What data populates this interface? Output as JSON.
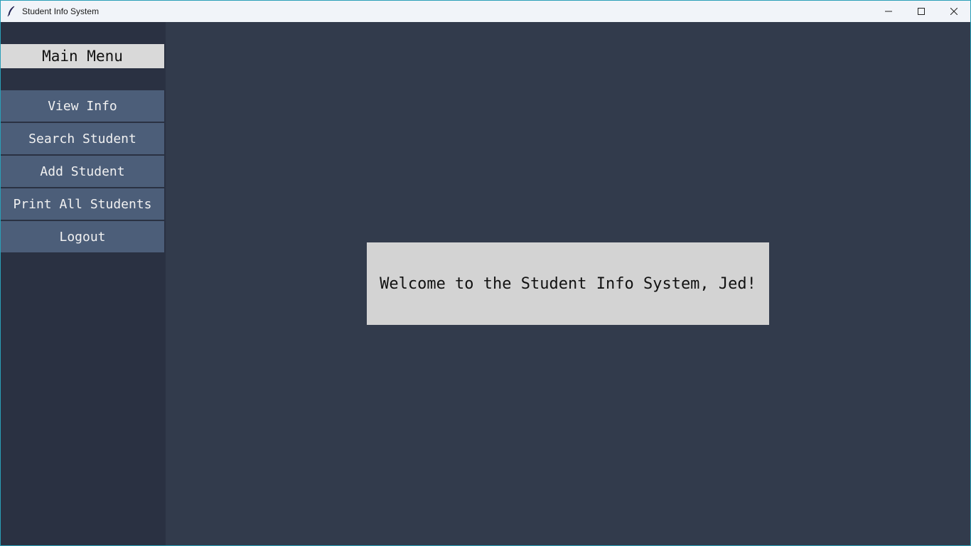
{
  "window": {
    "title": "Student Info System",
    "icon": "feather-icon"
  },
  "window_controls": [
    "minimize-icon",
    "maximize-icon",
    "close-icon"
  ],
  "sidebar": {
    "title": "Main Menu",
    "items": [
      {
        "label": "View Info"
      },
      {
        "label": "Search Student"
      },
      {
        "label": "Add Student"
      },
      {
        "label": "Print All Students"
      },
      {
        "label": "Logout"
      }
    ]
  },
  "main": {
    "welcome_message": "Welcome to the Student Info System, Jed!"
  },
  "colors": {
    "background": "#323b4c",
    "sidebar": "#2a3142",
    "nav_button": "#4c5e79",
    "panel": "#d3d3d3"
  }
}
